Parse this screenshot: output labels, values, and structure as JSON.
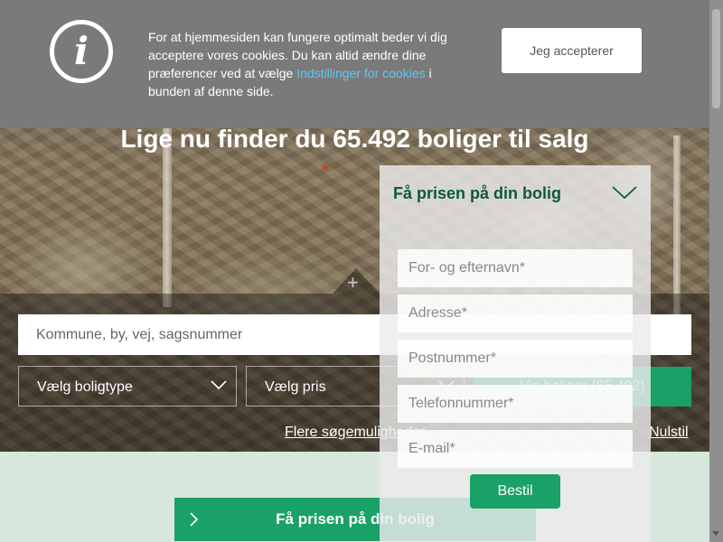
{
  "cookie_banner": {
    "text_before_link": "For at hjemmesiden kan fungere optimalt beder vi dig acceptere vores cookies. Du kan altid ændre dine præferencer ved at vælge ",
    "link_text": "Indstillinger for cookies",
    "text_after_link": " i bunden af denne side.",
    "accept_label": "Jeg accepterer",
    "icon": "info-icon"
  },
  "hero": {
    "title": "Lige nu finder du 65.492 boliger til salg"
  },
  "search": {
    "placeholder": "Kommune, by, vej, sagsnummer",
    "property_type_label": "Vælg boligtype",
    "price_label": "Vælg pris",
    "show_button_label": "Vis boliger (65.492)",
    "more_options_label": "Flere søgemuligheder",
    "reset_label": "Nulstil"
  },
  "price_form": {
    "title": "Få prisen på din bolig",
    "fields": [
      {
        "placeholder": "For- og efternavn*"
      },
      {
        "placeholder": "Adresse*"
      },
      {
        "placeholder": "Postnummer*"
      },
      {
        "placeholder": "Telefonnummer*"
      },
      {
        "placeholder": "E-mail*"
      }
    ],
    "submit_label": "Bestil"
  },
  "cta": {
    "label": "Få prisen på din bolig"
  },
  "colors": {
    "brand_green": "#1aa167",
    "title_green": "#0a5a3a",
    "cookie_bg": "#7a7a7a",
    "link_blue": "#5cc8f0"
  }
}
